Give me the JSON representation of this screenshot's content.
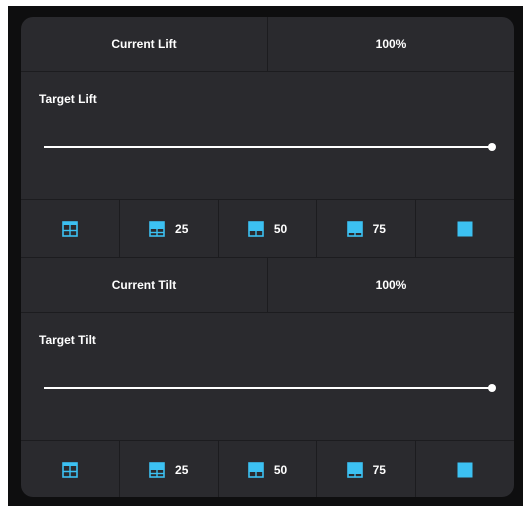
{
  "colors": {
    "accent": "#3cc1f2",
    "panel": "#2a2a2e",
    "text": "#ffffff"
  },
  "lift": {
    "current_label": "Current Lift",
    "current_value": "100%",
    "target_label": "Target Lift",
    "target_value": 1.0,
    "presets": [
      {
        "icon": "blind-open-icon",
        "label": ""
      },
      {
        "icon": "blind-25-icon",
        "label": "25"
      },
      {
        "icon": "blind-50-icon",
        "label": "50"
      },
      {
        "icon": "blind-75-icon",
        "label": "75"
      },
      {
        "icon": "blind-closed-icon",
        "label": ""
      }
    ]
  },
  "tilt": {
    "current_label": "Current Tilt",
    "current_value": "100%",
    "target_label": "Target Tilt",
    "target_value": 1.0,
    "presets": [
      {
        "icon": "blind-open-icon",
        "label": ""
      },
      {
        "icon": "blind-25-icon",
        "label": "25"
      },
      {
        "icon": "blind-50-icon",
        "label": "50"
      },
      {
        "icon": "blind-75-icon",
        "label": "75"
      },
      {
        "icon": "blind-closed-icon",
        "label": ""
      }
    ]
  }
}
